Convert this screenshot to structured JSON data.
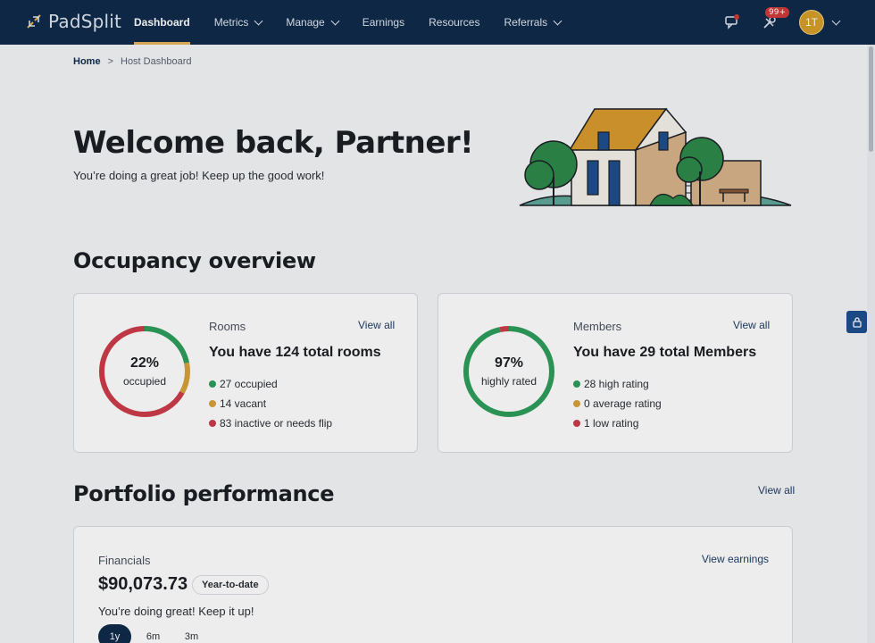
{
  "brand": {
    "name": "PadSplit"
  },
  "nav": {
    "items": [
      {
        "label": "Dashboard",
        "active": true,
        "dropdown": false
      },
      {
        "label": "Metrics",
        "active": false,
        "dropdown": true
      },
      {
        "label": "Manage",
        "active": false,
        "dropdown": true
      },
      {
        "label": "Earnings",
        "active": false,
        "dropdown": false
      },
      {
        "label": "Resources",
        "active": false,
        "dropdown": false
      },
      {
        "label": "Referrals",
        "active": false,
        "dropdown": true
      }
    ],
    "messages_icon": "chat-icon",
    "tools_icon": "tools-icon",
    "notifications_badge": "99+",
    "avatar_initials": "1T"
  },
  "breadcrumb": {
    "home": "Home",
    "separator": ">",
    "current": "Host Dashboard"
  },
  "hero": {
    "title": "Welcome back, Partner!",
    "subtitle": "You’re doing a great job! Keep up the good work!"
  },
  "occupancy": {
    "heading": "Occupancy overview",
    "rooms": {
      "label": "Rooms",
      "link": "View all",
      "title": "You have 124 total rooms",
      "ring_pct": "22%",
      "ring_label": "occupied",
      "stats": [
        {
          "text": "27 occupied",
          "color": "#2e9e5b",
          "value": 27
        },
        {
          "text": "14 vacant",
          "color": "#d9a23a",
          "value": 14
        },
        {
          "text": "83 inactive or needs flip",
          "color": "#cc3d4a",
          "value": 83
        }
      ]
    },
    "members": {
      "label": "Members",
      "link": "View all",
      "title": "You have 29 total Members",
      "ring_pct": "97%",
      "ring_label": "highly rated",
      "stats": [
        {
          "text": "28 high rating",
          "color": "#2e9e5b",
          "value": 28
        },
        {
          "text": "0 average rating",
          "color": "#d9a23a",
          "value": 0
        },
        {
          "text": "1 low rating",
          "color": "#cc3d4a",
          "value": 1
        }
      ]
    }
  },
  "portfolio": {
    "heading": "Portfolio performance",
    "link": "View all",
    "financials": {
      "label": "Financials",
      "amount": "$90,073.73",
      "period": "Year-to-date",
      "link": "View earnings",
      "message": "You’re doing great! Keep it up!",
      "ranges": [
        {
          "label": "1y",
          "active": true
        },
        {
          "label": "6m",
          "active": false
        },
        {
          "label": "3m",
          "active": false
        }
      ]
    }
  },
  "colors": {
    "navy": "#0f2a4a",
    "accent": "#e7b25c",
    "green": "#2e9e5b",
    "yellow": "#d9a23a",
    "red": "#cc3d4a"
  }
}
